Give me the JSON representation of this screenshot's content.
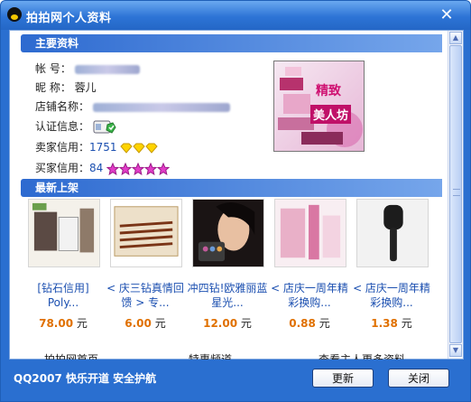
{
  "window": {
    "title": "拍拍网个人资料"
  },
  "sections": {
    "main_info": "主要资料",
    "latest": "最新上架"
  },
  "profile": {
    "account_label": "帐      号：",
    "nickname_label": "昵      称：",
    "nickname": "蓉儿",
    "shop_label": "店铺名称：",
    "verify_label": "认证信息：",
    "seller_label": "卖家信用：",
    "seller_credit": "1751",
    "buyer_label": "买家信用：",
    "buyer_credit": "84"
  },
  "shop_logo": {
    "line1": "精致",
    "line2": "美人坊"
  },
  "items": [
    {
      "name": "[钻石信用] Poly...",
      "price": "78.00",
      "unit": "元"
    },
    {
      "name": "< 庆三钻真情回馈 > 专...",
      "price": "6.00",
      "unit": "元"
    },
    {
      "name": "冲四钻!欧雅丽蓝星光...",
      "price": "12.00",
      "unit": "元"
    },
    {
      "name": "< 店庆一周年精彩换购...",
      "price": "0.88",
      "unit": "元"
    },
    {
      "name": "< 店庆一周年精彩换购...",
      "price": "1.38",
      "unit": "元"
    }
  ],
  "footer_links": [
    "拍拍网首页",
    "特惠频道",
    "查看主人更多资料"
  ],
  "bottom": {
    "slogan": "QQ2007 快乐开道 安全护航",
    "refresh": "更新",
    "close": "关闭"
  },
  "colors": {
    "titlebar": "#2d74d6",
    "section": "#2d6ad0",
    "price": "#e07000",
    "link": "#1b4fb0"
  }
}
